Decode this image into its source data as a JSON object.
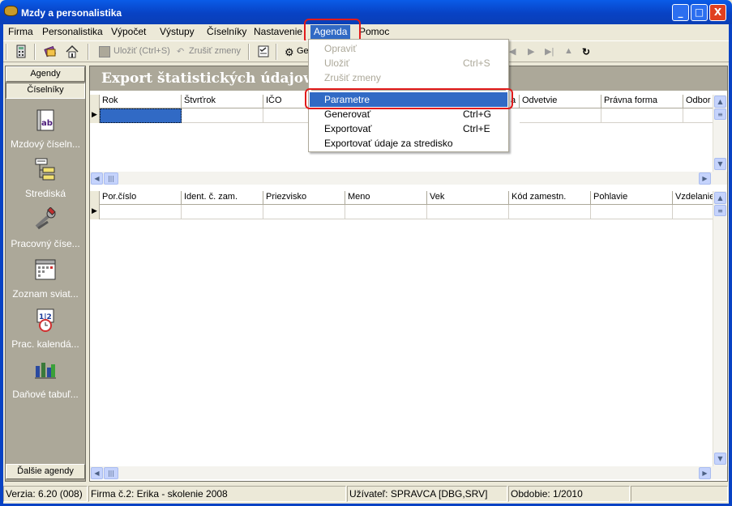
{
  "window": {
    "title": "Mzdy a personalistika",
    "buttons": [
      "_",
      "□",
      "X"
    ]
  },
  "menu": [
    {
      "label": "Firma",
      "key": "firma"
    },
    {
      "label": "Personalistika",
      "key": "personalistika"
    },
    {
      "label": "Výpočet",
      "key": "vypocet"
    },
    {
      "label": "Výstupy",
      "key": "vystupy"
    },
    {
      "label": "Číselníky",
      "key": "ciselniky"
    },
    {
      "label": "Nastavenie",
      "key": "nastavenie"
    },
    {
      "label": "Agenda",
      "key": "agenda"
    },
    {
      "label": "Pomoc",
      "key": "pomoc"
    }
  ],
  "toolbar": {
    "save_label": "Uložiť (Ctrl+S)",
    "cancel_label": "Zrušiť zmeny",
    "generate_label": "Ge"
  },
  "agenda_menu": [
    {
      "label": "Opraviť",
      "shortcut": ""
    },
    {
      "label": "Uložiť",
      "shortcut": "Ctrl+S"
    },
    {
      "label": "Zrušiť zmeny",
      "shortcut": ""
    },
    {
      "label": "Parametre",
      "shortcut": ""
    },
    {
      "label": "Generovať",
      "shortcut": "Ctrl+G"
    },
    {
      "label": "Exportovať",
      "shortcut": "Ctrl+E"
    },
    {
      "label": "Exportovať údaje za stredisko",
      "shortcut": ""
    }
  ],
  "sidebar": {
    "agendy_label": "Agendy",
    "ciselniky_label": "Číselníky",
    "dalsie_label": "Ďalšie agendy",
    "items": [
      {
        "label": "Mzdový číseln...",
        "icon": "book-icon"
      },
      {
        "label": "Strediská",
        "icon": "org-chart-icon"
      },
      {
        "label": "Pracovný číse...",
        "icon": "tools-icon"
      },
      {
        "label": "Zoznam sviat...",
        "icon": "calendar-icon"
      },
      {
        "label": "Prac. kalendá...",
        "icon": "calendar-clock-icon"
      },
      {
        "label": "Daňové tabuľ...",
        "icon": "chart-icon"
      }
    ]
  },
  "main": {
    "header_title": "Export štatistických údajov za",
    "grid1_columns": [
      "Rok",
      "Štvrťrok",
      "IČO",
      "",
      "",
      "",
      "Odvetvie",
      "Právna forma",
      "Odbor"
    ],
    "grid1_partial_letter": "a",
    "grid2_columns": [
      "Por.číslo",
      "Ident. č. zam.",
      "Priezvisko",
      "Meno",
      "Vek",
      "Kód zamestn.",
      "Pohlavie",
      "Vzdelanie"
    ]
  },
  "status": {
    "version": "Verzia: 6.20 (008)",
    "company": "Firma č.2: Erika - skolenie 2008",
    "user": "Užívateľ: SPRAVCA [DBG,SRV]",
    "period": "Obdobie: 1/2010",
    "empty": ""
  },
  "colors": {
    "highlight": "#316ac5",
    "title_bar": "#0842c4",
    "annotation": "#e21b1b"
  }
}
